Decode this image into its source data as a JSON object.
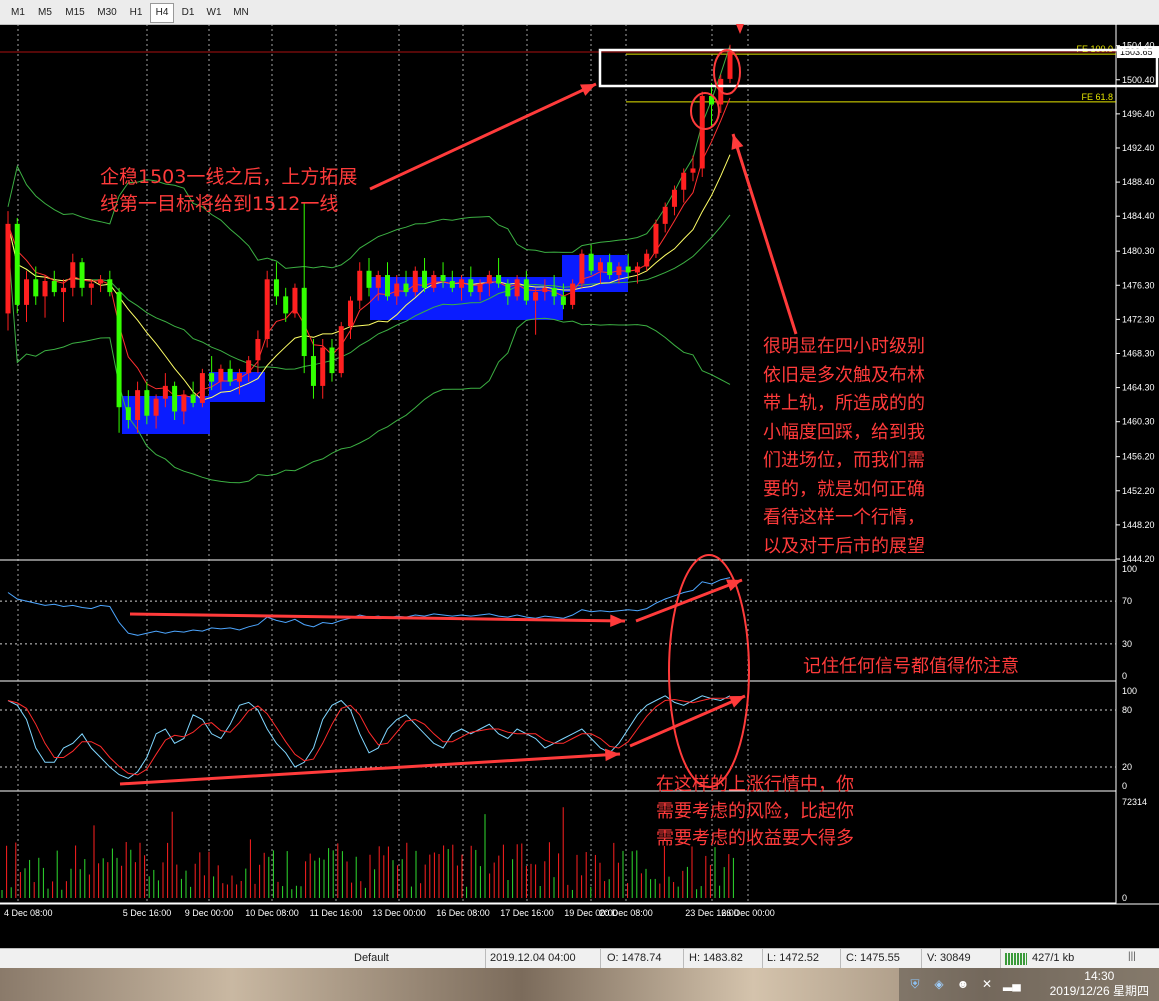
{
  "toolbar": {
    "timeframes": [
      "M1",
      "M5",
      "M15",
      "M30",
      "H1",
      "H4",
      "D1",
      "W1",
      "MN"
    ],
    "active": "H4"
  },
  "price_axis": {
    "labels": [
      "1504.40",
      "1500.40",
      "1496.40",
      "1492.40",
      "1488.40",
      "1484.40",
      "1480.30",
      "1476.30",
      "1472.30",
      "1468.30",
      "1464.30",
      "1460.30",
      "1456.20",
      "1452.20",
      "1448.20",
      "1444.20"
    ],
    "current_price": "1503.65",
    "fe100_label": "FE 100.0",
    "fe618_label": "FE 61.8"
  },
  "rsi_axis": [
    "100",
    "70",
    "30",
    "0"
  ],
  "stoch_axis": [
    "100",
    "80",
    "20",
    "0"
  ],
  "volume_axis": [
    "72314",
    "0"
  ],
  "time_axis": [
    "4 Dec 08:00",
    "5 Dec 16:00",
    "9 Dec 00:00",
    "10 Dec 08:00",
    "11 Dec 16:00",
    "13 Dec 00:00",
    "16 Dec 08:00",
    "17 Dec 16:00",
    "19 Dec 00:00",
    "20 Dec 08:00",
    "23 Dec 16:00",
    "26 Dec 00:00"
  ],
  "annotations": {
    "note1": "企稳1503一线之后，上方拓展\n线第一目标将给到1512一线",
    "note2": "很明显在四小时级别\n依旧是多次触及布林\n带上轨，所造成的的\n小幅度回踩，给到我\n们进场位，而我们需\n要的，就是如何正确\n看待这样一个行情，\n以及对于后市的展望",
    "note3": "记住任何信号都值得你注意",
    "note4": "在这样的上涨行情中，你\n需要考虑的风险，比起你\n需要考虑的收益要大得多"
  },
  "status_bar": {
    "profile": "Default",
    "datetime": "2019.12.04 04:00",
    "open": "O: 1478.74",
    "high": "H: 1483.82",
    "low": "L: 1472.52",
    "close": "C: 1475.55",
    "volume": "V: 30849",
    "traffic": "427/1 kb"
  },
  "taskbar": {
    "time": "14:30",
    "date": "2019/12/26 星期四"
  },
  "colors": {
    "bull": "#ff2020",
    "bear": "#33ff00",
    "bollinger": "#3cb043",
    "ma": "#ffff66",
    "ema": "#ff3030",
    "rsi": "#4da6ff",
    "stoch_main": "#7fd6ff",
    "stoch_signal": "#ff2b2b",
    "box": "#0a1cff",
    "annotation": "#ff3b3b"
  },
  "chart_data": {
    "type": "candlestick",
    "series": [
      {
        "name": "price",
        "ohlc": [
          [
            1473.0,
            1485.0,
            1471.0,
            1483.5
          ],
          [
            1483.5,
            1484.2,
            1473.0,
            1474.0
          ],
          [
            1474.0,
            1478.0,
            1472.0,
            1477.0
          ],
          [
            1477.0,
            1478.5,
            1474.0,
            1475.0
          ],
          [
            1475.0,
            1477.5,
            1472.5,
            1476.8
          ],
          [
            1476.8,
            1478.0,
            1475.0,
            1475.5
          ],
          [
            1475.5,
            1477.0,
            1472.0,
            1476.0
          ],
          [
            1476.0,
            1480.0,
            1475.0,
            1479.0
          ],
          [
            1479.0,
            1479.5,
            1475.0,
            1476.0
          ],
          [
            1476.0,
            1477.0,
            1474.0,
            1476.5
          ],
          [
            1476.5,
            1477.5,
            1475.5,
            1477.0
          ],
          [
            1477.0,
            1478.0,
            1475.0,
            1475.5
          ],
          [
            1475.5,
            1476.0,
            1459.0,
            1462.0
          ],
          [
            1462.0,
            1464.0,
            1459.5,
            1460.5
          ],
          [
            1460.5,
            1465.0,
            1459.0,
            1464.0
          ],
          [
            1464.0,
            1465.0,
            1460.0,
            1461.0
          ],
          [
            1461.0,
            1463.5,
            1459.5,
            1463.0
          ],
          [
            1463.0,
            1466.0,
            1462.0,
            1464.5
          ],
          [
            1464.5,
            1465.0,
            1460.5,
            1461.5
          ],
          [
            1461.5,
            1464.0,
            1460.0,
            1463.5
          ],
          [
            1463.5,
            1465.0,
            1462.0,
            1462.5
          ],
          [
            1462.5,
            1466.5,
            1462.0,
            1466.0
          ],
          [
            1466.0,
            1468.0,
            1464.0,
            1465.0
          ],
          [
            1465.0,
            1467.0,
            1464.0,
            1466.5
          ],
          [
            1466.5,
            1467.5,
            1464.5,
            1465.0
          ],
          [
            1465.0,
            1466.5,
            1463.5,
            1466.0
          ],
          [
            1466.0,
            1468.0,
            1465.0,
            1467.5
          ],
          [
            1467.5,
            1471.0,
            1466.0,
            1470.0
          ],
          [
            1470.0,
            1478.0,
            1469.0,
            1477.0
          ],
          [
            1477.0,
            1479.0,
            1474.0,
            1475.0
          ],
          [
            1475.0,
            1476.0,
            1472.0,
            1473.0
          ],
          [
            1473.0,
            1476.5,
            1472.5,
            1476.0
          ],
          [
            1476.0,
            1486.0,
            1466.0,
            1468.0
          ],
          [
            1468.0,
            1470.0,
            1463.0,
            1464.5
          ],
          [
            1464.5,
            1470.0,
            1463.0,
            1469.0
          ],
          [
            1469.0,
            1470.0,
            1465.0,
            1466.0
          ],
          [
            1466.0,
            1472.0,
            1465.5,
            1471.5
          ],
          [
            1471.5,
            1475.0,
            1470.0,
            1474.5
          ],
          [
            1474.5,
            1479.0,
            1473.5,
            1478.0
          ],
          [
            1478.0,
            1479.5,
            1475.0,
            1476.0
          ],
          [
            1476.0,
            1478.0,
            1474.5,
            1477.5
          ],
          [
            1477.5,
            1479.0,
            1474.5,
            1475.0
          ],
          [
            1475.0,
            1477.5,
            1474.0,
            1476.5
          ],
          [
            1476.5,
            1478.0,
            1475.0,
            1475.5
          ],
          [
            1475.5,
            1478.5,
            1475.0,
            1478.0
          ],
          [
            1478.0,
            1479.5,
            1475.5,
            1476.0
          ],
          [
            1476.0,
            1478.0,
            1475.5,
            1477.5
          ],
          [
            1477.5,
            1479.0,
            1476.0,
            1476.8
          ],
          [
            1476.8,
            1478.0,
            1475.5,
            1476.0
          ],
          [
            1476.0,
            1477.5,
            1474.5,
            1477.0
          ],
          [
            1477.0,
            1478.5,
            1475.0,
            1475.5
          ],
          [
            1475.5,
            1477.0,
            1474.5,
            1476.5
          ],
          [
            1476.5,
            1478.0,
            1475.0,
            1477.5
          ],
          [
            1477.5,
            1479.5,
            1476.0,
            1476.5
          ],
          [
            1476.5,
            1477.0,
            1474.0,
            1475.0
          ],
          [
            1475.0,
            1477.5,
            1474.5,
            1477.0
          ],
          [
            1477.0,
            1478.0,
            1474.0,
            1474.5
          ],
          [
            1474.5,
            1476.0,
            1470.5,
            1475.5
          ],
          [
            1475.5,
            1477.0,
            1474.5,
            1476.0
          ],
          [
            1476.0,
            1477.5,
            1474.0,
            1475.0
          ],
          [
            1475.0,
            1476.5,
            1473.5,
            1474.0
          ],
          [
            1474.0,
            1477.0,
            1473.5,
            1476.5
          ],
          [
            1476.5,
            1480.5,
            1476.0,
            1480.0
          ],
          [
            1480.0,
            1481.0,
            1477.5,
            1478.0
          ],
          [
            1478.0,
            1479.5,
            1476.5,
            1479.0
          ],
          [
            1479.0,
            1480.0,
            1477.0,
            1477.5
          ],
          [
            1477.5,
            1479.0,
            1476.5,
            1478.5
          ],
          [
            1478.5,
            1480.0,
            1477.0,
            1477.8
          ],
          [
            1477.8,
            1479.0,
            1476.5,
            1478.5
          ],
          [
            1478.5,
            1480.5,
            1478.0,
            1480.0
          ],
          [
            1480.0,
            1484.0,
            1479.5,
            1483.5
          ],
          [
            1483.5,
            1486.0,
            1482.5,
            1485.5
          ],
          [
            1485.5,
            1488.0,
            1484.5,
            1487.5
          ],
          [
            1487.5,
            1490.0,
            1486.0,
            1489.5
          ],
          [
            1489.5,
            1491.5,
            1488.5,
            1490.0
          ],
          [
            1490.0,
            1499.0,
            1489.0,
            1498.5
          ],
          [
            1498.5,
            1500.0,
            1495.0,
            1497.5
          ],
          [
            1497.5,
            1501.0,
            1496.5,
            1500.5
          ],
          [
            1500.5,
            1504.5,
            1500.0,
            1503.65
          ]
        ]
      }
    ],
    "x": [
      "4 Dec 08:00",
      "5 Dec 16:00",
      "9 Dec 00:00",
      "10 Dec 08:00",
      "11 Dec 16:00",
      "13 Dec 00:00",
      "16 Dec 08:00",
      "17 Dec 16:00",
      "19 Dec 00:00",
      "20 Dec 08:00",
      "23 Dec 16:00",
      "26 Dec 00:00"
    ],
    "ylim": [
      1444.2,
      1506.0
    ],
    "fib_levels": [
      {
        "label": "FE 100.0",
        "value": 1503.4
      },
      {
        "label": "FE 61.8",
        "value": 1497.8
      }
    ],
    "horizontal_line": 1503.65,
    "rsi_levels": [
      70,
      30
    ],
    "stoch_levels": [
      80,
      20
    ],
    "volume_max": 72314,
    "grid": true
  }
}
